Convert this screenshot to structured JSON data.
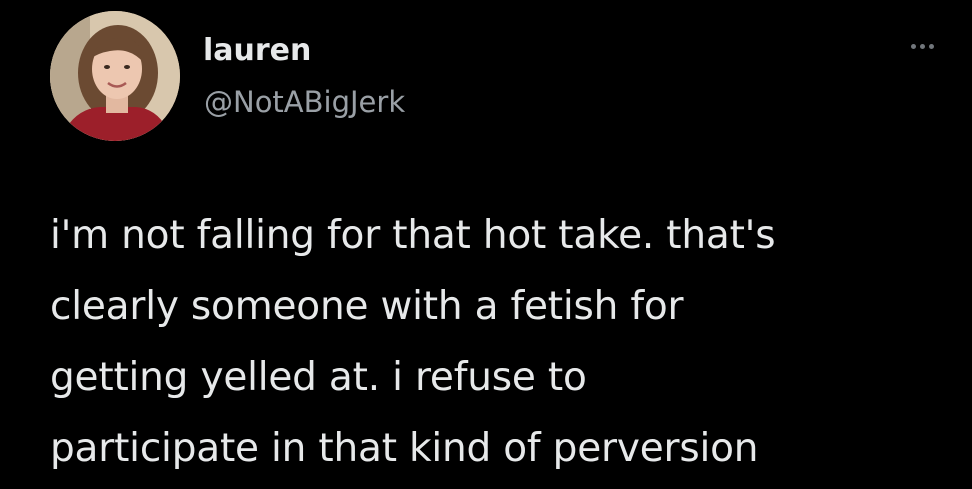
{
  "tweet": {
    "author": {
      "display_name": "lauren",
      "handle": "@NotABigJerk",
      "avatar_icon": "user-avatar-photo"
    },
    "more_icon": "ellipsis-icon",
    "text": "i'm not falling for that hot take. that's\nclearly someone with a fetish for\ngetting yelled at. i refuse to\nparticipate in that kind of perversion"
  },
  "colors": {
    "background": "#000000",
    "text_primary": "#e7e9ea",
    "text_secondary": "#9aa0a6"
  }
}
